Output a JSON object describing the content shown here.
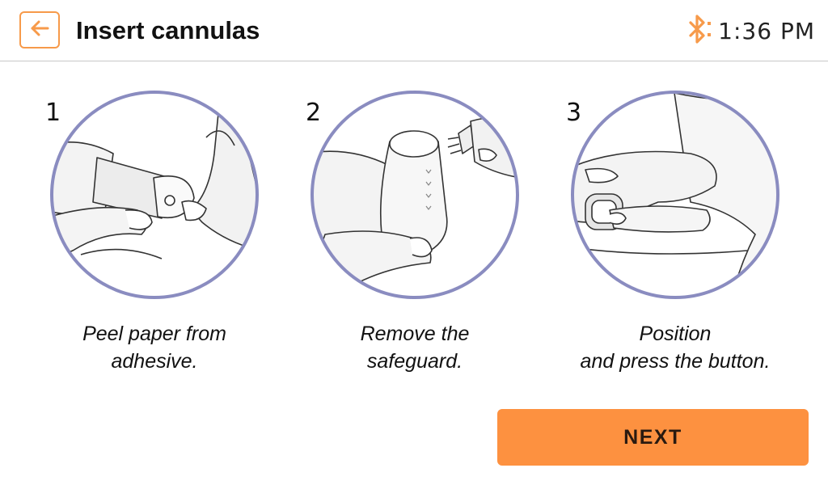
{
  "header": {
    "back_icon": "arrow-left-icon",
    "title": "Insert cannulas",
    "bluetooth_icon": "bluetooth-icon",
    "time": "1:36 PM",
    "accent_color": "#f79a4a"
  },
  "steps": [
    {
      "number": "1",
      "caption": "Peel paper from\nadhesive."
    },
    {
      "number": "2",
      "caption": "Remove the\nsafeguard."
    },
    {
      "number": "3",
      "caption": "Position\nand press the button."
    }
  ],
  "actions": {
    "next_label": "NEXT",
    "next_color": "#fd9140"
  },
  "illustration_ring_color": "#8a8cc0"
}
